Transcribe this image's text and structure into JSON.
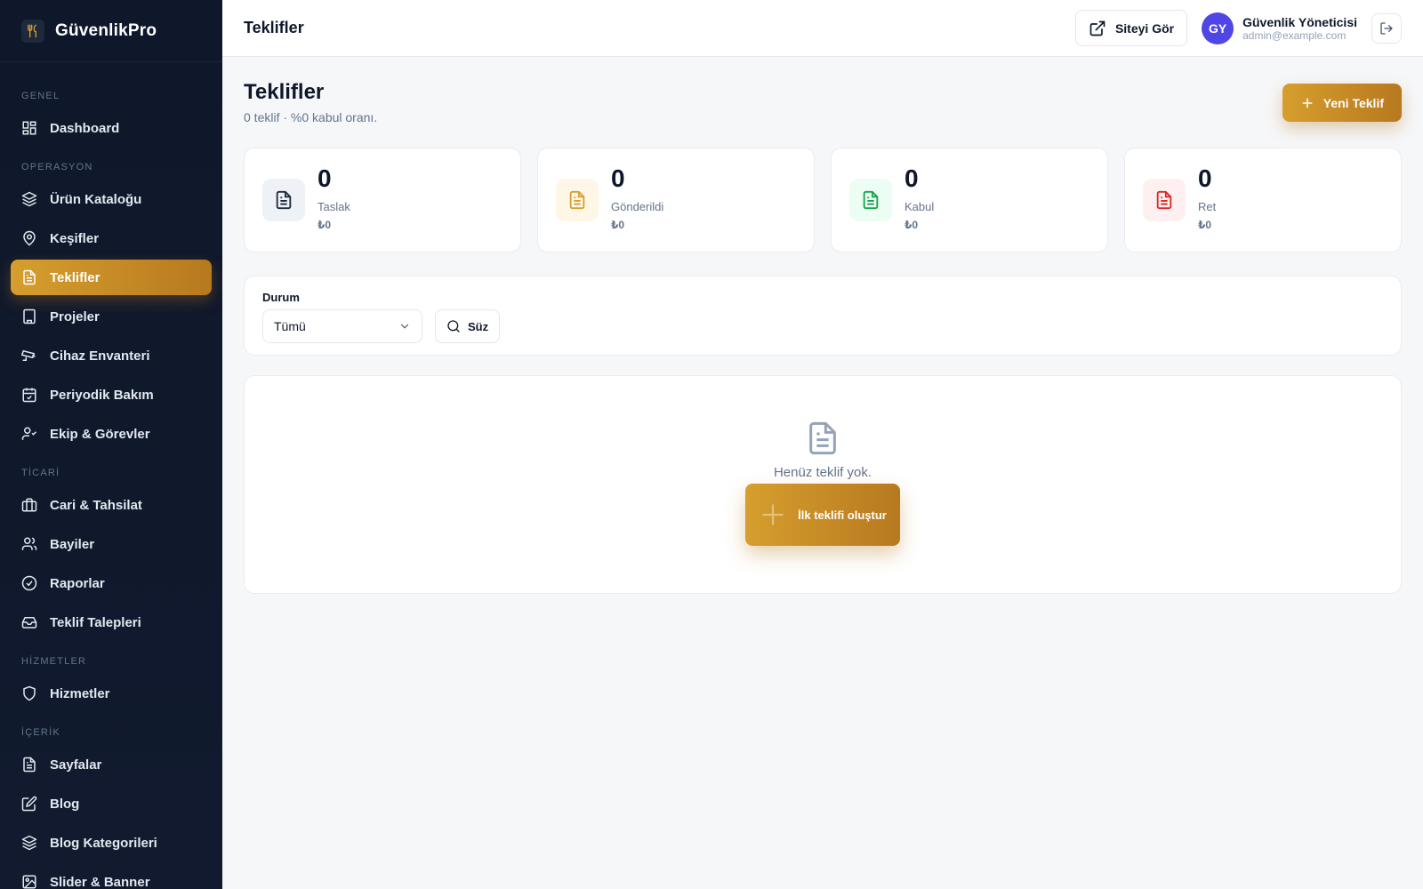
{
  "brand": {
    "name": "GüvenlikPro",
    "icon": "utensils-icon"
  },
  "sidebar": {
    "sections": [
      {
        "title": "GENEL",
        "items": [
          {
            "label": "Dashboard",
            "icon": "grid-icon"
          }
        ]
      },
      {
        "title": "OPERASYON",
        "items": [
          {
            "label": "Ürün Kataloğu",
            "icon": "layers-icon"
          },
          {
            "label": "Keşifler",
            "icon": "map-pin-icon"
          },
          {
            "label": "Teklifler",
            "icon": "file-text-icon",
            "active": true
          },
          {
            "label": "Projeler",
            "icon": "building-icon"
          },
          {
            "label": "Cihaz Envanteri",
            "icon": "cctv-icon"
          },
          {
            "label": "Periyodik Bakım",
            "icon": "calendar-check-icon"
          },
          {
            "label": "Ekip & Görevler",
            "icon": "user-check-icon"
          }
        ]
      },
      {
        "title": "TİCARİ",
        "items": [
          {
            "label": "Cari & Tahsilat",
            "icon": "briefcase-icon"
          },
          {
            "label": "Bayiler",
            "icon": "users-icon"
          },
          {
            "label": "Raporlar",
            "icon": "gauge-icon"
          },
          {
            "label": "Teklif Talepleri",
            "icon": "inbox-icon"
          }
        ]
      },
      {
        "title": "HİZMETLER",
        "items": [
          {
            "label": "Hizmetler",
            "icon": "shield-icon"
          }
        ]
      },
      {
        "title": "İÇERİK",
        "items": [
          {
            "label": "Sayfalar",
            "icon": "file-text-icon"
          },
          {
            "label": "Blog",
            "icon": "edit-icon"
          },
          {
            "label": "Blog Kategorileri",
            "icon": "layers-icon"
          },
          {
            "label": "Slider & Banner",
            "icon": "image-icon"
          }
        ]
      }
    ]
  },
  "header": {
    "title": "Teklifler",
    "view_site": "Siteyi Gör",
    "user": {
      "initials": "GY",
      "name": "Güvenlik Yöneticisi",
      "email": "admin@example.com"
    }
  },
  "page": {
    "title": "Teklifler",
    "subtitle": "0 teklif · %0 kabul oranı.",
    "new_button": "Yeni Teklif"
  },
  "stats": [
    {
      "value": "0",
      "label": "Taslak",
      "amount": "₺0",
      "color": "#334155",
      "bg": "#eef2f7"
    },
    {
      "value": "0",
      "label": "Gönderildi",
      "amount": "₺0",
      "color": "#d69e2e",
      "bg": "#fef6e7"
    },
    {
      "value": "0",
      "label": "Kabul",
      "amount": "₺0",
      "color": "#16a34a",
      "bg": "#ecfdf3"
    },
    {
      "value": "0",
      "label": "Ret",
      "amount": "₺0",
      "color": "#dc2626",
      "bg": "#fef0f0"
    }
  ],
  "filter": {
    "label": "Durum",
    "selected": "Tümü",
    "button": "Süz"
  },
  "empty": {
    "text": "Henüz teklif yok.",
    "button": "İlk teklifi oluştur"
  },
  "colors": {
    "accent": "#d69e2e",
    "accent_dark": "#b7791f",
    "sidebar_bg": "#0f172a",
    "avatar": "#4f46e5"
  }
}
